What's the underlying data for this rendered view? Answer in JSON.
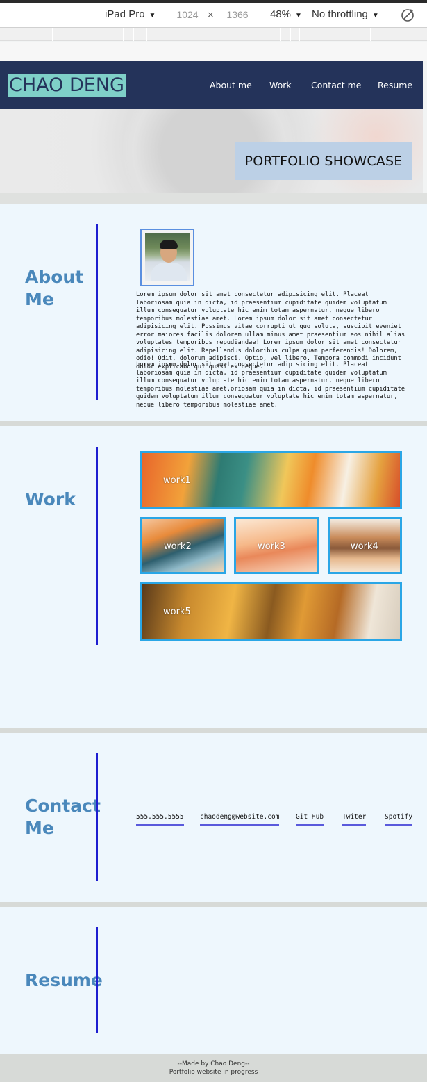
{
  "devtools": {
    "device": "iPad Pro",
    "width": "1024",
    "times": "×",
    "height": "1366",
    "zoom": "48%",
    "throttling": "No throttling",
    "rotate_icon": "rotate-icon"
  },
  "site": {
    "logo": "CHAO DENG",
    "nav": [
      "About me",
      "Work",
      "Contact me",
      "Resume"
    ],
    "hero_title": "PORTFOLIO SHOWCASE"
  },
  "about": {
    "title_line1": "About",
    "title_line2": "Me",
    "para1": "Lorem ipsum dolor sit amet consectetur adipisicing elit. Placeat laboriosam quia in dicta, id praesentium cupiditate quidem voluptatum illum consequatur voluptate hic enim totam aspernatur, neque libero temporibus molestiae amet. Lorem ipsum dolor sit amet consectetur adipisicing elit. Possimus vitae corrupti ut quo soluta, suscipit eveniet error maiores facilis dolorem ullam minus amet praesentium eos nihil alias voluptates temporibus repudiandae! Lorem ipsum dolor sit amet consectetur adipisicing elit. Repellendus doloribus culpa quam perferendis! Dolorem, odio! Odit, dolorum adipisci. Optio, vel libero. Tempora commodi incidunt dolor explicabo qui quasi ex neque.",
    "para2": "Lorem ipsum dolor sit amet consectetur adipisicing elit. Placeat laboriosam quia in dicta, id praesentium cupiditate quidem voluptatum illum consequatur voluptate hic enim totam aspernatur, neque libero temporibus molestiae amet.oriosam quia in dicta, id praesentium cupiditate quidem voluptatum illum consequatur voluptate hic enim totam aspernatur, neque libero temporibus molestiae amet."
  },
  "work": {
    "title": "Work",
    "tiles": [
      "work1",
      "work2",
      "work3",
      "work4",
      "work5"
    ]
  },
  "contact": {
    "title_line1": "Contact",
    "title_line2": "Me",
    "links": [
      "555.555.5555",
      "chaodeng@website.com",
      "Git Hub",
      "Twiter",
      "Spotify"
    ]
  },
  "resume": {
    "title": "Resume"
  },
  "footer": {
    "line1": "--Made by Chao Deng--",
    "line2": "Portfolio website in progress"
  },
  "colors": {
    "nav_bg": "#24335a",
    "logo_bg": "#7fd0c8",
    "section_bg": "#eef7fd",
    "title": "#4a88bb",
    "accent_line": "#1e1ed0",
    "tile_border": "#2aa6e6"
  }
}
